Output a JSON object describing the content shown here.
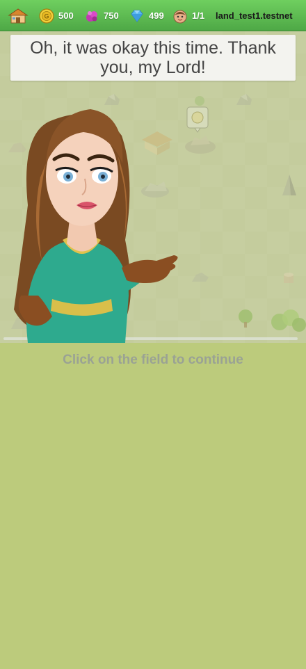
{
  "topbar": {
    "gold": "500",
    "gems": "750",
    "diamonds": "499",
    "population": "1/1",
    "account": "land_test1.testnet"
  },
  "dialog": {
    "text": "Oh, it was okay this time. Thank you, my Lord!"
  },
  "hint": "Click on the field to continue",
  "icons": {
    "home": "house-icon",
    "gold": "gold-coin-icon",
    "gems": "purple-gem-icon",
    "diamonds": "blue-diamond-icon",
    "population": "villager-face-icon",
    "marker": "gold-coin-marker-icon"
  },
  "colors": {
    "topbar": "#5bbd4f",
    "background": "#bccb7c",
    "dialog_bg": "#f3f3ef",
    "hint_text": "#9aa294"
  }
}
